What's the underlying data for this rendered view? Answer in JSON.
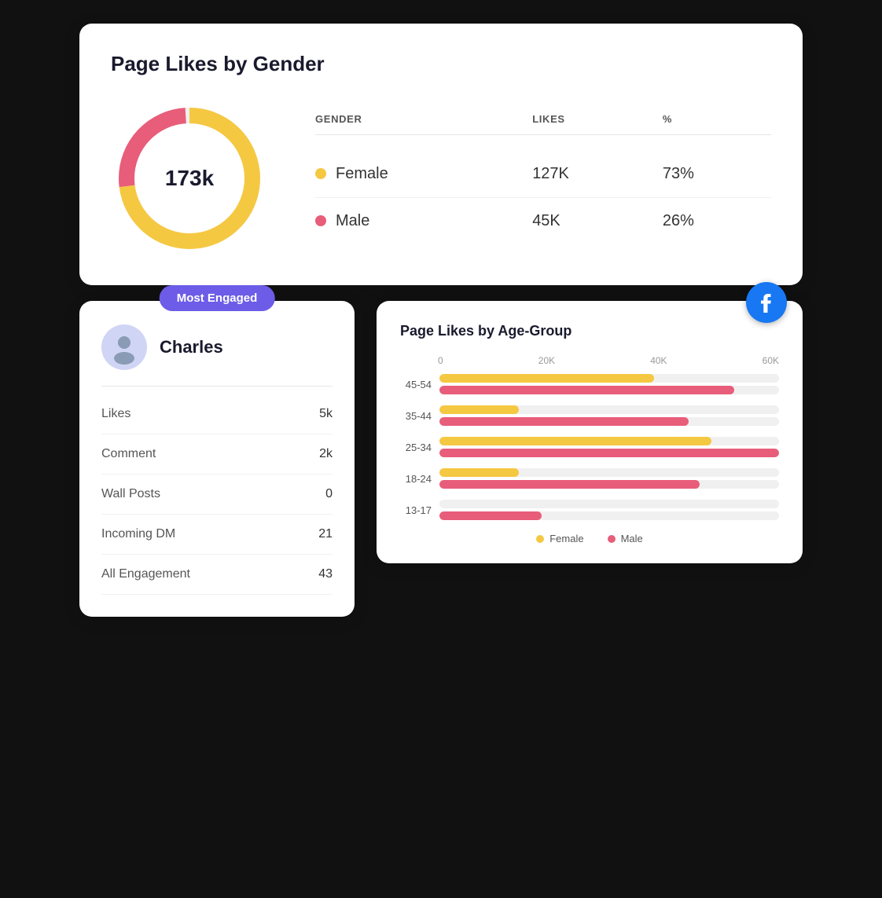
{
  "top_card": {
    "title": "Page Likes by Gender",
    "total": "173k",
    "donut": {
      "female_pct": 73,
      "male_pct": 26,
      "female_color": "#f5c842",
      "male_color": "#e85d7a",
      "radius": 80,
      "stroke_width": 20
    },
    "table": {
      "headers": [
        "GENDER",
        "LIKES",
        "%"
      ],
      "rows": [
        {
          "label": "Female",
          "dot": "female",
          "likes": "127K",
          "pct": "73%"
        },
        {
          "label": "Male",
          "dot": "male",
          "likes": "45K",
          "pct": "26%"
        }
      ]
    }
  },
  "most_engaged_card": {
    "badge": "Most Engaged",
    "user_name": "Charles",
    "stats": [
      {
        "label": "Likes",
        "value": "5k"
      },
      {
        "label": "Comment",
        "value": "2k"
      },
      {
        "label": "Wall Posts",
        "value": "0"
      },
      {
        "label": "Incoming DM",
        "value": "21"
      },
      {
        "label": "All Engagement",
        "value": "43"
      }
    ]
  },
  "age_chart": {
    "title": "Page Likes by Age-Group",
    "axis_labels": [
      "0",
      "20K",
      "40K",
      "60K"
    ],
    "max_value": 60000,
    "rows": [
      {
        "age": "45-54",
        "female": 38000,
        "male": 52000
      },
      {
        "age": "35-44",
        "female": 14000,
        "male": 44000
      },
      {
        "age": "25-34",
        "female": 48000,
        "male": 60000
      },
      {
        "age": "18-24",
        "female": 14000,
        "male": 46000
      },
      {
        "age": "13-17",
        "female": 0,
        "male": 18000
      }
    ],
    "legend": [
      {
        "label": "Female",
        "color": "#f5c842"
      },
      {
        "label": "Male",
        "color": "#e85d7a"
      }
    ]
  }
}
